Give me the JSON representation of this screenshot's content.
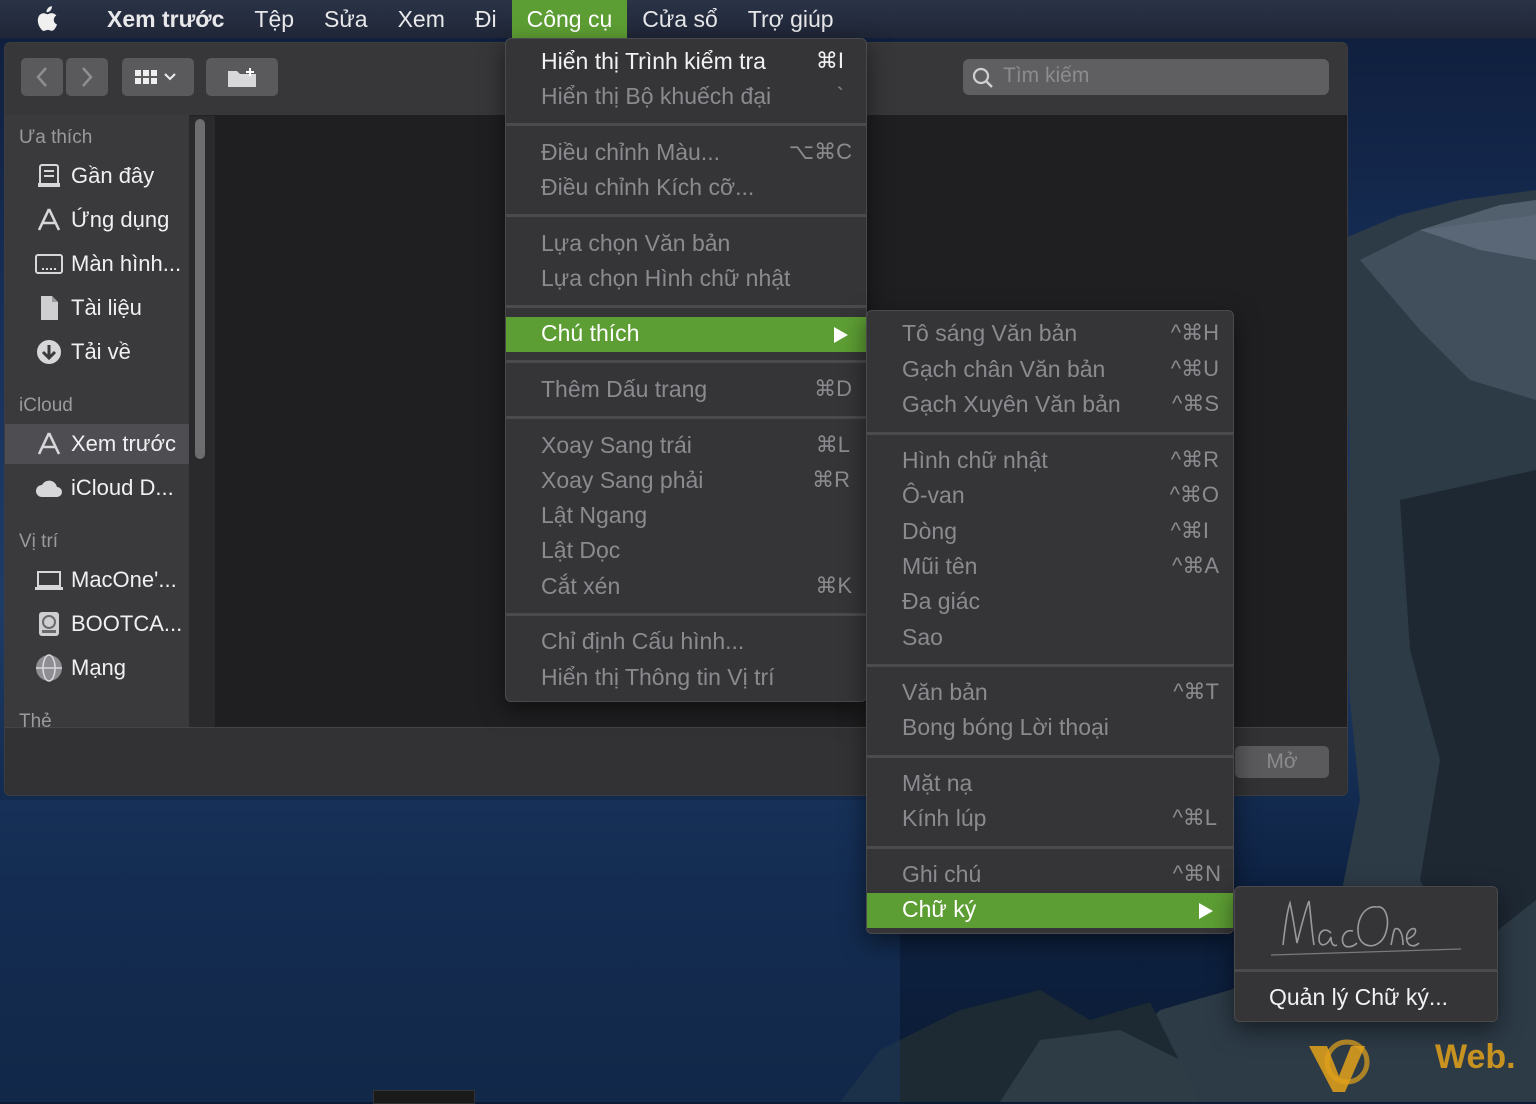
{
  "menubar": {
    "items": [
      "Xem trước",
      "Tệp",
      "Sửa",
      "Xem",
      "Đi",
      "Công cụ",
      "Cửa sổ",
      "Trợ giúp"
    ]
  },
  "toolbar": {
    "search_placeholder": "Tìm kiếm"
  },
  "sidebar": {
    "favorites_heading": "Ưa thích",
    "favorites": [
      "Gần đây",
      "Ứng dụng",
      "Màn hình...",
      "Tài liệu",
      "Tải về"
    ],
    "icloud_heading": "iCloud",
    "icloud": [
      "Xem trước",
      "iCloud D..."
    ],
    "locations_heading": "Vị trí",
    "locations": [
      "MacOne'...",
      "BOOTCA...",
      "Mạng"
    ],
    "tags_heading": "Thẻ"
  },
  "bottom_bar": {
    "open_label": "Mở"
  },
  "tools_menu": {
    "items": [
      {
        "label": "Hiển thị Trình kiểm tra",
        "shortcut": "⌘I"
      },
      {
        "label": "Hiển thị Bộ khuếch đại",
        "shortcut": "`"
      },
      {
        "label": "Điều chỉnh Màu...",
        "shortcut": "⌥⌘C"
      },
      {
        "label": "Điều chỉnh Kích cỡ...",
        "shortcut": ""
      },
      {
        "label": "Lựa chọn Văn bản",
        "shortcut": ""
      },
      {
        "label": "Lựa chọn Hình chữ nhật",
        "shortcut": ""
      },
      {
        "label": "Chú thích",
        "shortcut": ""
      },
      {
        "label": "Thêm Dấu trang",
        "shortcut": "⌘D"
      },
      {
        "label": "Xoay Sang trái",
        "shortcut": "⌘L"
      },
      {
        "label": "Xoay Sang phải",
        "shortcut": "⌘R"
      },
      {
        "label": "Lật Ngang",
        "shortcut": ""
      },
      {
        "label": "Lật Dọc",
        "shortcut": ""
      },
      {
        "label": "Cắt xén",
        "shortcut": "⌘K"
      },
      {
        "label": "Chỉ định Cấu hình...",
        "shortcut": ""
      },
      {
        "label": "Hiển thị Thông tin Vị trí",
        "shortcut": ""
      }
    ]
  },
  "annotate_menu": {
    "items": [
      {
        "label": "Tô sáng Văn bản",
        "shortcut": "^⌘H"
      },
      {
        "label": "Gạch chân Văn bản",
        "shortcut": "^⌘U"
      },
      {
        "label": "Gạch Xuyên Văn bản",
        "shortcut": "^⌘S"
      },
      {
        "label": "Hình chữ nhật",
        "shortcut": "^⌘R"
      },
      {
        "label": "Ô-van",
        "shortcut": "^⌘O"
      },
      {
        "label": "Dòng",
        "shortcut": "^⌘I"
      },
      {
        "label": "Mũi tên",
        "shortcut": "^⌘A"
      },
      {
        "label": "Đa giác",
        "shortcut": ""
      },
      {
        "label": "Sao",
        "shortcut": ""
      },
      {
        "label": "Văn bản",
        "shortcut": "^⌘T"
      },
      {
        "label": "Bong bóng Lời thoại",
        "shortcut": ""
      },
      {
        "label": "Mặt nạ",
        "shortcut": ""
      },
      {
        "label": "Kính lúp",
        "shortcut": "^⌘L"
      },
      {
        "label": "Ghi chú",
        "shortcut": "^⌘N"
      },
      {
        "label": "Chữ ký",
        "shortcut": ""
      }
    ]
  },
  "signature_menu": {
    "signature_text": "MacOne",
    "manage_label": "Quản lý Chữ ký..."
  },
  "watermark": {
    "brand_text": "Web."
  },
  "colors": {
    "highlight": "#5d9e34",
    "menu_bg": "#353538"
  }
}
